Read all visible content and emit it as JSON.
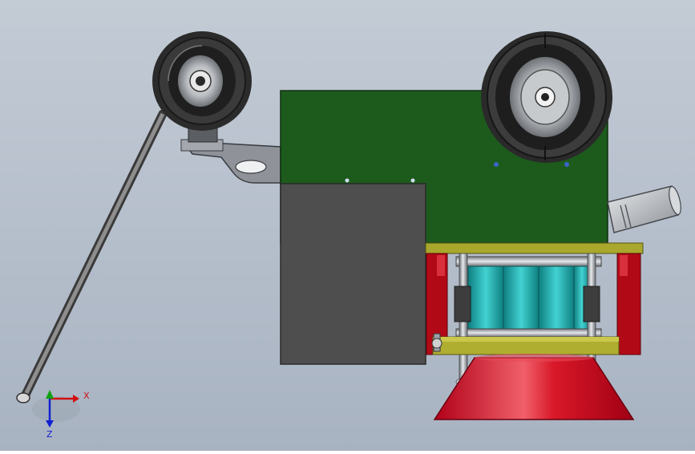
{
  "viewport": {
    "background_top": "#c4ccd6",
    "background_bottom": "#a9b4c3"
  },
  "triad": {
    "x_label": "X",
    "z_label": "Z",
    "x_color": "#d01010",
    "y_color": "#10a010",
    "z_color": "#1020d0"
  },
  "colors": {
    "green_body": "#1c5a1c",
    "gray_panel": "#4d4d4d",
    "red_parts": "#cc1020",
    "cyan_cylinder": "#1aa6a6",
    "olive_plate": "#a8a82a",
    "metal": "#9aa0a8",
    "tire": "#2a2a2a"
  }
}
